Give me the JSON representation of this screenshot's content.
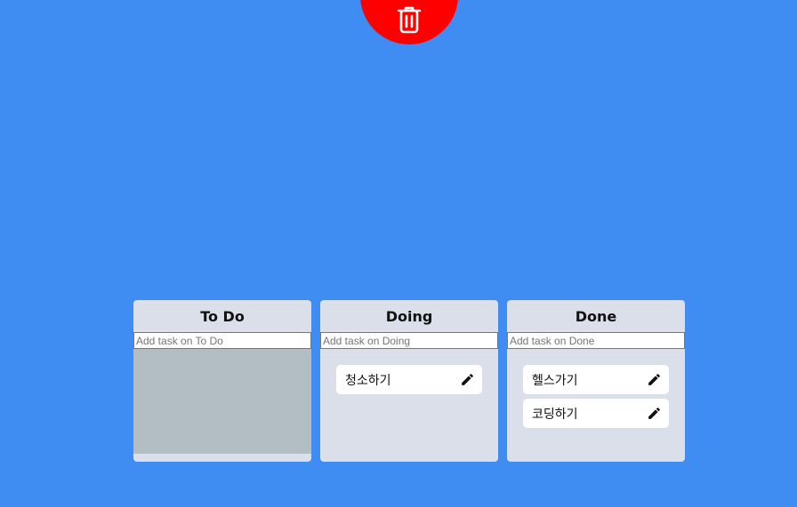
{
  "trash": {
    "icon": "trash-icon",
    "color": "#ff0000"
  },
  "colors": {
    "background": "#3f8cf2",
    "board": "#dadfe9",
    "drop_highlight": "#b2bec3",
    "card": "#ffffff"
  },
  "boards": [
    {
      "title": "To Do",
      "placeholder": "Add task on To Do",
      "dragging_over": true,
      "cards": []
    },
    {
      "title": "Doing",
      "placeholder": "Add task on Doing",
      "dragging_over": false,
      "cards": [
        {
          "text": "청소하기",
          "icon": "pencil-icon"
        }
      ]
    },
    {
      "title": "Done",
      "placeholder": "Add task on Done",
      "dragging_over": false,
      "cards": [
        {
          "text": "헬스가기",
          "icon": "pencil-icon"
        },
        {
          "text": "코딩하기",
          "icon": "pencil-icon"
        }
      ]
    }
  ]
}
